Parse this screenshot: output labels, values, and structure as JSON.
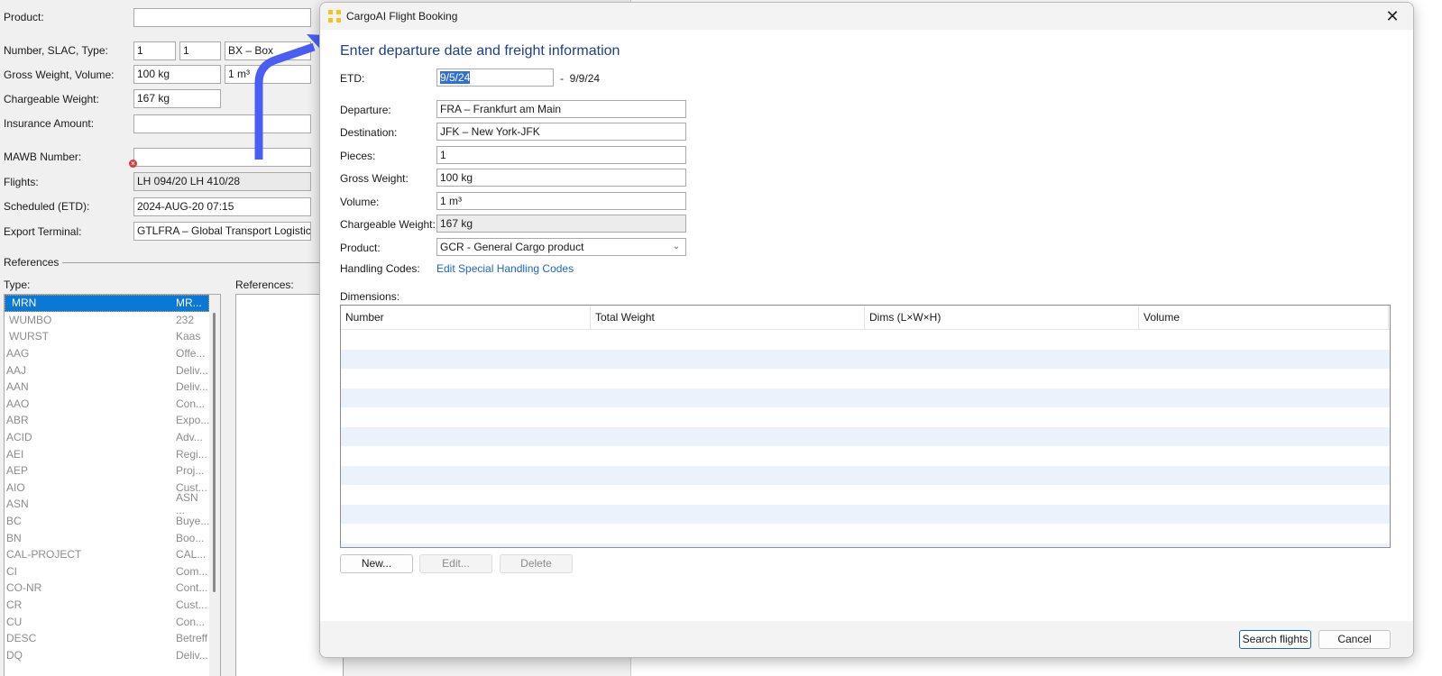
{
  "background_form": {
    "fields": [
      {
        "label": "Product:",
        "values": [
          ""
        ]
      },
      {
        "label": "Number, SLAC, Type:",
        "values": [
          "1",
          "1",
          "BX – Box"
        ]
      },
      {
        "label": "Gross Weight, Volume:",
        "values": [
          "100 kg",
          "1 m³"
        ]
      },
      {
        "label": "Chargeable Weight:",
        "values": [
          "167 kg"
        ]
      },
      {
        "label": "Insurance Amount:",
        "values": [
          ""
        ]
      },
      {
        "label": "MAWB Number:",
        "values": [
          ""
        ]
      },
      {
        "label": "Flights:",
        "values": [
          "LH 094/20 LH 410/28"
        ]
      },
      {
        "label": "Scheduled (ETD):",
        "values": [
          "2024-AUG-20 07:15"
        ]
      },
      {
        "label": "Export Terminal:",
        "values": [
          "GTLFRA – Global Transport Logistics I"
        ]
      }
    ],
    "references_group": "References",
    "type_label": "Type:",
    "references_label": "References:",
    "reference_types": [
      {
        "code": "MRN",
        "desc": "MR...",
        "selected": true
      },
      {
        "code": "WUMBO",
        "desc": "232"
      },
      {
        "code": "WURST",
        "desc": "Kaas"
      },
      {
        "code": "AAG",
        "desc": "Offe..."
      },
      {
        "code": "AAJ",
        "desc": "Deliv..."
      },
      {
        "code": "AAN",
        "desc": "Deliv..."
      },
      {
        "code": "AAO",
        "desc": "Con..."
      },
      {
        "code": "ABR",
        "desc": "Expo..."
      },
      {
        "code": "ACID",
        "desc": "Adv..."
      },
      {
        "code": "AEI",
        "desc": "Regi..."
      },
      {
        "code": "AEP",
        "desc": "Proj..."
      },
      {
        "code": "AIO",
        "desc": "Cust..."
      },
      {
        "code": "ASN",
        "desc": "ASN ..."
      },
      {
        "code": "BC",
        "desc": "Buye..."
      },
      {
        "code": "BN",
        "desc": "Boo..."
      },
      {
        "code": "CAL-PROJECT",
        "desc": "CAL..."
      },
      {
        "code": "CI",
        "desc": "Com..."
      },
      {
        "code": "CO-NR",
        "desc": "Cont..."
      },
      {
        "code": "CR",
        "desc": "Cust..."
      },
      {
        "code": "CU",
        "desc": "Con..."
      },
      {
        "code": "DESC",
        "desc": "Betreff"
      },
      {
        "code": "DQ",
        "desc": "Deliv..."
      }
    ]
  },
  "dialog": {
    "title": "CargoAI Flight Booking",
    "heading": "Enter departure date and freight information",
    "etd": {
      "label": "ETD:",
      "from": "9/5/24",
      "separator": "-",
      "to": "9/9/24"
    },
    "fields": {
      "departure": {
        "label": "Departure:",
        "value": "FRA – Frankfurt am Main"
      },
      "destination": {
        "label": "Destination:",
        "value": "JFK – New York-JFK"
      },
      "pieces": {
        "label": "Pieces:",
        "value": "1"
      },
      "gross_weight": {
        "label": "Gross Weight:",
        "value": "100 kg"
      },
      "volume": {
        "label": "Volume:",
        "value": "1 m³"
      },
      "chargeable_weight": {
        "label": "Chargeable Weight:",
        "value": "167 kg"
      },
      "product": {
        "label": "Product:",
        "value": "GCR - General Cargo product"
      },
      "handling_codes": {
        "label": "Handling Codes:",
        "link": "Edit Special Handling Codes"
      }
    },
    "dimensions": {
      "label": "Dimensions:",
      "columns": [
        "Number",
        "Total Weight",
        "Dims (L×W×H)",
        "Volume"
      ],
      "rows": []
    },
    "buttons": {
      "new": "New...",
      "edit": "Edit...",
      "delete": "Delete",
      "search": "Search flights",
      "cancel": "Cancel"
    },
    "close_glyph": "✕"
  },
  "colors": {
    "accent": "#0a78d7",
    "heading": "#1e3f8a",
    "link": "#1a66c8",
    "arrow": "#4a5ef5",
    "app_icon": "#f5c518",
    "error": "#e0383a"
  }
}
